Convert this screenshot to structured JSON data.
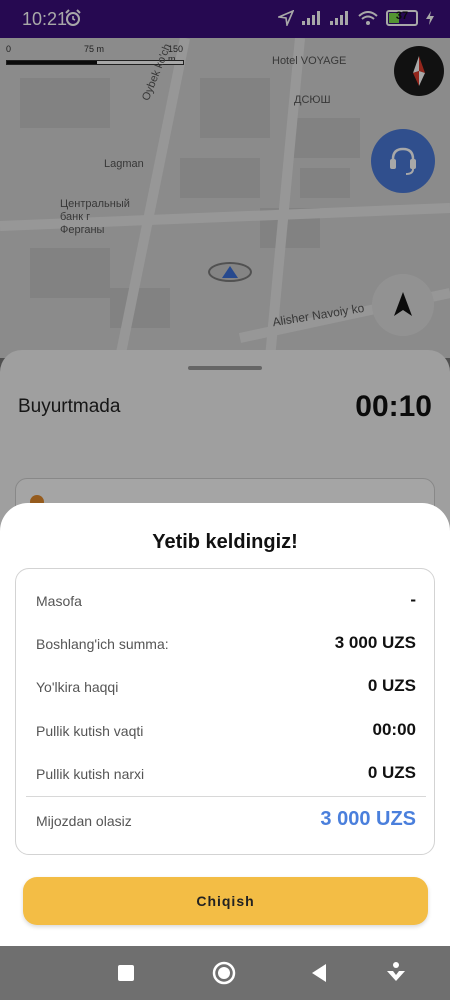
{
  "status_bar": {
    "time": "10:21",
    "battery_level": "37",
    "battery_fraction": 0.37,
    "icons": [
      "alarm-icon",
      "location-arrow-icon",
      "signal-icon",
      "signal-icon",
      "wifi-icon",
      "battery-icon",
      "charging-icon"
    ]
  },
  "map": {
    "scale_labels": [
      "0",
      "75 m",
      "150 m"
    ],
    "labels": {
      "hotel": "Hotel VOYAGE",
      "dsyush": "ДСЮШ",
      "oybek": "Oybek ko'ch",
      "lagman": "Lagman",
      "bank": "Центральный банк г Ферганы",
      "alisher": "Alisher Navoiy ko"
    }
  },
  "panel": {
    "status_label": "Buyurtmada",
    "timer": "00:10"
  },
  "modal": {
    "title": "Yetib keldingiz!",
    "rows": [
      {
        "label": "Masofa",
        "value": "-"
      },
      {
        "label": "Boshlang'ich summa:",
        "value": "3 000 UZS"
      },
      {
        "label": "Yo'lkira haqqi",
        "value": "0 UZS"
      },
      {
        "label": "Pullik kutish vaqti",
        "value": "00:00"
      },
      {
        "label": "Pullik kutish narxi",
        "value": "0 UZS"
      }
    ],
    "total": {
      "label": "Mijozdan olasiz",
      "value": "3 000 UZS"
    },
    "exit_button": "Chiqish"
  },
  "colors": {
    "status_bar": "#3a0e7c",
    "accent_blue": "#4a7fdc",
    "button_yellow": "#f3bd45"
  }
}
